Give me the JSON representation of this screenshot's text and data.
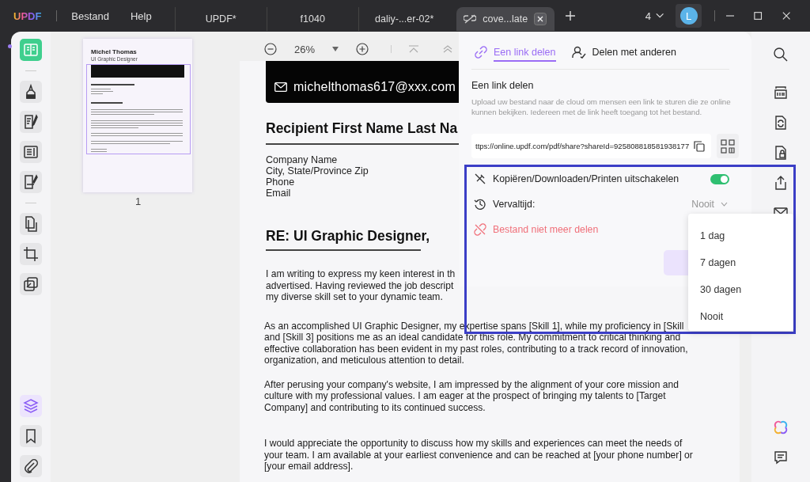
{
  "titlebar": {
    "logo": "UPDF",
    "menus": [
      "Bestand",
      "Help"
    ],
    "tabs": [
      {
        "label": "UPDF*",
        "selected": false
      },
      {
        "label": "f1040",
        "selected": false
      },
      {
        "label": "daliy-...er-02*",
        "selected": false
      },
      {
        "label": "cove...late",
        "selected": true
      }
    ],
    "window_count": "4",
    "avatar": "L"
  },
  "left_toolbar": {
    "groups": [
      [
        {
          "kind": "reader",
          "selected": true
        }
      ],
      [
        {
          "kind": "highlight",
          "selected": false
        },
        {
          "kind": "edit",
          "selected": false
        },
        {
          "kind": "form",
          "selected": false
        },
        {
          "kind": "sign",
          "selected": false
        }
      ],
      [
        {
          "kind": "pages",
          "selected": false
        },
        {
          "kind": "crop",
          "selected": false
        },
        {
          "kind": "batch",
          "selected": false
        }
      ]
    ],
    "bottom": [
      {
        "kind": "layers",
        "selected": true
      },
      {
        "kind": "bookmark",
        "selected": false
      },
      {
        "kind": "attachment",
        "selected": false
      }
    ]
  },
  "thumbnail": {
    "name": "Michel Thomas",
    "role": "UI Graphic Designer",
    "page": "1"
  },
  "zoom_bar": {
    "zoom": "26%"
  },
  "document": {
    "email": "michelthomas617@xxx.com",
    "recipient_heading": "Recipient First Name Last Na",
    "address_lines": [
      "Company Name",
      "City, State/Province Zip",
      "Phone",
      "Email"
    ],
    "subject": "RE: UI Graphic Designer,",
    "paragraphs": [
      [
        "I am writing to express my keen interest in th",
        "advertised. Having reviewed the job descript",
        "my diverse skill set to your dynamic team."
      ],
      [
        "As an accomplished UI Graphic Designer, my expertise spans [Skill 1], while my proficiency in [Skill",
        "and [Skill 3] positions me as an ideal candidate for this role. My commitment to critical thinking and",
        "effective collaboration has been evident in my past roles, contributing to a track record of innovation,",
        "organization, and meticulous attention to detail."
      ],
      [
        "After perusing your company's website, I am impressed by the alignment of your core mission and",
        "culture with my professional values. I am eager at the prospect of bringing my talents to [Target",
        "Company] and contributing to its continued success."
      ],
      [
        "I would appreciate the opportunity to discuss how my skills and experiences can meet the needs of",
        "your team. I am available at your earliest convenience and can be reached at [your phone number] or",
        "[your email address]."
      ]
    ]
  },
  "share_panel": {
    "tabs": [
      {
        "label": "Een link delen",
        "kind": "link",
        "selected": true
      },
      {
        "label": "Delen met anderen",
        "kind": "people",
        "selected": false
      }
    ],
    "heading": "Een link delen",
    "description": "Upload uw bestand naar de cloud om mensen een link te sturen die ze online kunnen bekijken. Iedereen met de link heeft toegang tot het bestand.",
    "link": "ttps://online.updf.com/pdf/share?shareId=925808818581938177",
    "disable_copy": {
      "label": "Kopiëren/Downloaden/Printen uitschakelen",
      "on": true
    },
    "expiry": {
      "label": "Vervaltijd:",
      "value": "Nooit"
    },
    "stop_sharing": "Bestand niet meer delen"
  },
  "expiry_menu": {
    "options": [
      "1 dag",
      "7 dagen",
      "30 dagen",
      "Nooit"
    ]
  },
  "right_toolbar": {
    "top": [
      {
        "kind": "search"
      },
      {
        "kind": "ocr"
      },
      {
        "kind": "convert"
      },
      {
        "kind": "protect"
      },
      {
        "kind": "share"
      },
      {
        "kind": "mail"
      }
    ],
    "bottom": [
      {
        "kind": "ai"
      },
      {
        "kind": "comment"
      }
    ]
  }
}
